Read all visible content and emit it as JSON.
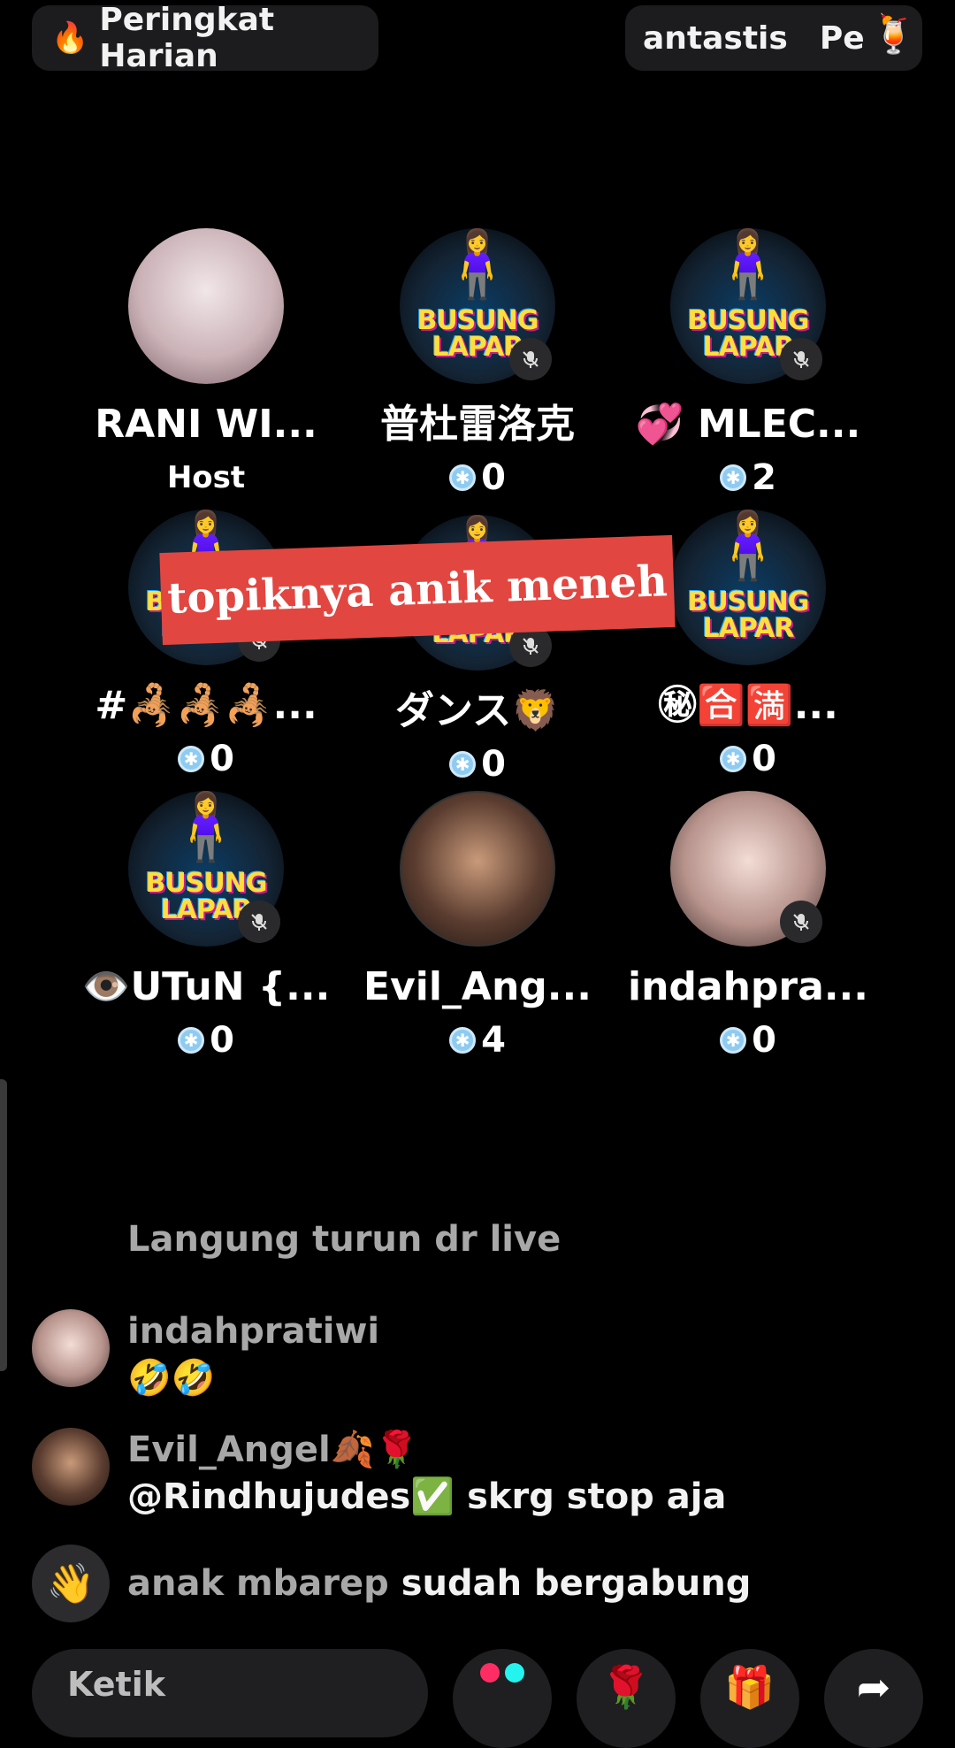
{
  "header": {
    "ranking_label": "Peringkat Harian",
    "right_label_1": "antastis",
    "right_label_2": "Pe"
  },
  "seats": [
    {
      "name": "RANI WI...",
      "sub": "Host"
    },
    {
      "name": "普杜雷洛克",
      "count": "0"
    },
    {
      "name": "💞 MLEC...",
      "count": "2"
    },
    {
      "name": "#🦂🦂🦂...",
      "count": "0"
    },
    {
      "name": "ダンス🦁",
      "count": "0"
    },
    {
      "name": "㊙🈴🈵...",
      "count": "0"
    },
    {
      "name": "👁️UTuN {...",
      "count": "0"
    },
    {
      "name": "Evil_Ang...",
      "count": "4"
    },
    {
      "name": "indahpra...",
      "count": "0"
    }
  ],
  "avatar_logo": {
    "line1": "BUSUNG",
    "line2": "LAPAR"
  },
  "topic_banner": "topiknya anik meneh",
  "chat": {
    "partial_message": "Langung turun dr live",
    "messages": [
      {
        "user": "indahpratiwi",
        "text": "🤣🤣"
      },
      {
        "user": "Evil_Angel🍂🌹",
        "text": "@Rindhujudes✅ skrg stop aja"
      }
    ],
    "join": {
      "user": "anak mbarep",
      "text": "sudah bergabung"
    }
  },
  "input": {
    "placeholder": "Ketik"
  },
  "colors": {
    "banner": "#e24640",
    "gem": "#8ecbf2"
  }
}
